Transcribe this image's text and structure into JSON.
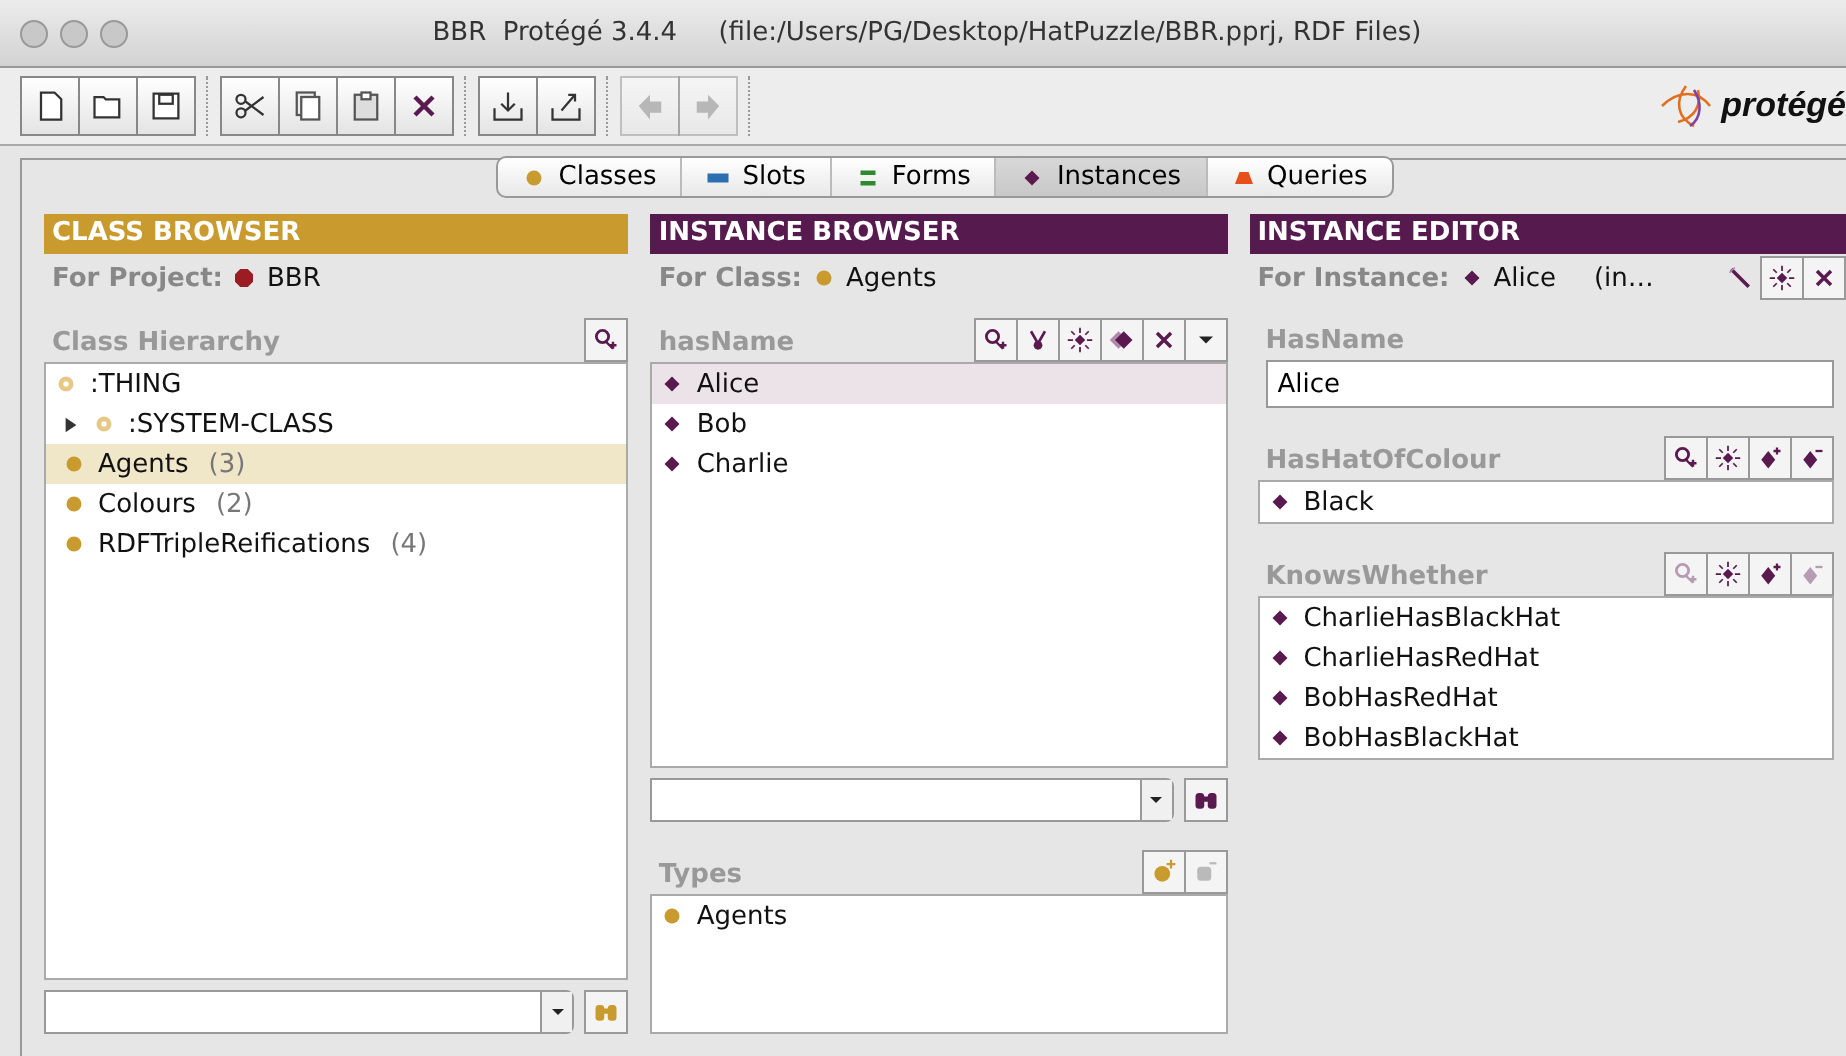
{
  "window": {
    "title": "BBR  Protégé 3.4.4     (file:/Users/PG/Desktop/HatPuzzle/BBR.pprj, RDF Files)"
  },
  "toolbar": {
    "groups": [
      [
        {
          "disabled": false
        },
        {
          "disabled": false
        },
        {
          "disabled": false
        }
      ],
      [
        {
          "disabled": false
        },
        {
          "disabled": false
        },
        {
          "disabled": false
        },
        {
          "disabled": false
        }
      ],
      [
        {
          "disabled": false
        },
        {
          "disabled": false
        }
      ],
      [
        {
          "disabled": true
        },
        {
          "disabled": true
        }
      ]
    ],
    "logo": "protégé"
  },
  "tabs": [
    {
      "label": "Classes",
      "selected": false
    },
    {
      "label": "Slots",
      "selected": false
    },
    {
      "label": "Forms",
      "selected": false
    },
    {
      "label": "Instances",
      "selected": true
    },
    {
      "label": "Queries",
      "selected": false
    }
  ],
  "class_browser": {
    "title": "CLASS BROWSER",
    "for_label": "For Project:",
    "project": "BBR",
    "hierarchy_label": "Class Hierarchy",
    "tree": [
      {
        "label": ":THING",
        "kind": "abstract",
        "selected": false,
        "children": [
          {
            "label": ":SYSTEM-CLASS",
            "kind": "abstract",
            "selected": false,
            "expanded": false
          },
          {
            "label": "Agents",
            "count": "(3)",
            "kind": "class",
            "selected": true
          },
          {
            "label": "Colours",
            "count": "(2)",
            "kind": "class",
            "selected": false
          },
          {
            "label": "RDFTripleReifications",
            "count": "(4)",
            "kind": "class",
            "selected": false
          }
        ]
      }
    ]
  },
  "instance_browser": {
    "title": "INSTANCE BROWSER",
    "for_label": "For Class:",
    "class": "Agents",
    "list_label": "hasName",
    "buttons": [
      {
        "disabled": false
      },
      {
        "disabled": false
      },
      {
        "disabled": false
      },
      {
        "disabled": false
      },
      {
        "disabled": false
      },
      {
        "disabled": false
      }
    ],
    "instances": [
      {
        "label": "Alice",
        "selected": true
      },
      {
        "label": "Bob",
        "selected": false
      },
      {
        "label": "Charlie",
        "selected": false
      }
    ],
    "types_label": "Types",
    "type_buttons": [
      {
        "disabled": false
      },
      {
        "disabled": true
      }
    ],
    "types": [
      "Agents"
    ]
  },
  "instance_editor": {
    "title": "INSTANCE EDITOR",
    "for_label": "For Instance:",
    "instance": "Alice",
    "suffix": "(in…",
    "slots": [
      {
        "label": "HasName",
        "kind": "text",
        "value": "Alice"
      },
      {
        "label": "HasHatOfColour",
        "kind": "list",
        "buttons": [
          {
            "disabled": false
          },
          {
            "disabled": false
          },
          {
            "disabled": false
          },
          {
            "disabled": false
          }
        ],
        "items": [
          "Black"
        ]
      },
      {
        "label": "KnowsWhether",
        "kind": "list",
        "buttons": [
          {
            "disabled": true
          },
          {
            "disabled": false
          },
          {
            "disabled": false
          },
          {
            "disabled": true
          }
        ],
        "items": [
          "CharlieHasBlackHat",
          "CharlieHasRedHat",
          "BobHasRedHat",
          "BobHasBlackHat"
        ]
      }
    ]
  }
}
